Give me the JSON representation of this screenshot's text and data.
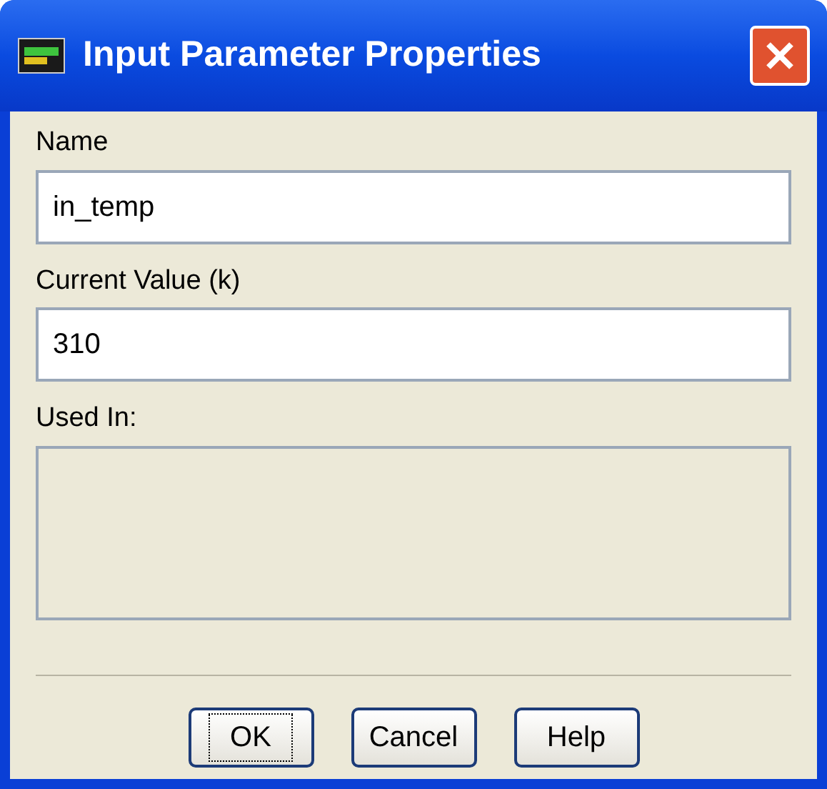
{
  "window": {
    "title": "Input Parameter Properties"
  },
  "fields": [
    {
      "label": "Name",
      "value": "in_temp"
    },
    {
      "label": "Current Value (k)",
      "value": "310"
    }
  ],
  "used_in": {
    "label": "Used In:"
  },
  "buttons": [
    {
      "label": "OK",
      "focused": true
    },
    {
      "label": "Cancel",
      "focused": false
    },
    {
      "label": "Help",
      "focused": false
    }
  ]
}
